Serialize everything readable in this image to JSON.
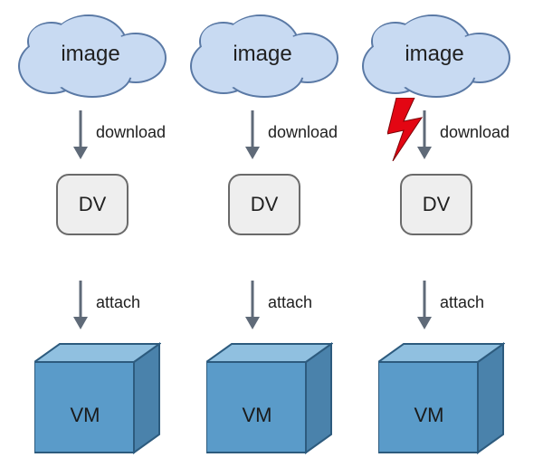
{
  "colors": {
    "cloud_fill": "#c8daf2",
    "cloud_stroke": "#5a79a5",
    "dv_fill": "#eeeeee",
    "dv_stroke": "#6a6a6a",
    "cube_front": "#5a9bc9",
    "cube_side": "#4a82ab",
    "cube_top": "#90c0e0",
    "cube_stroke": "#2d5b7e",
    "arrow": "#5f6a78",
    "bolt": "#e30613"
  },
  "columns": [
    {
      "cloud_label": "image",
      "arrow1_label": "download",
      "dv_label": "DV",
      "arrow2_label": "attach",
      "vm_label": "VM",
      "has_bolt": false
    },
    {
      "cloud_label": "image",
      "arrow1_label": "download",
      "dv_label": "DV",
      "arrow2_label": "attach",
      "vm_label": "VM",
      "has_bolt": false
    },
    {
      "cloud_label": "image",
      "arrow1_label": "download",
      "dv_label": "DV",
      "arrow2_label": "attach",
      "vm_label": "VM",
      "has_bolt": true
    }
  ]
}
